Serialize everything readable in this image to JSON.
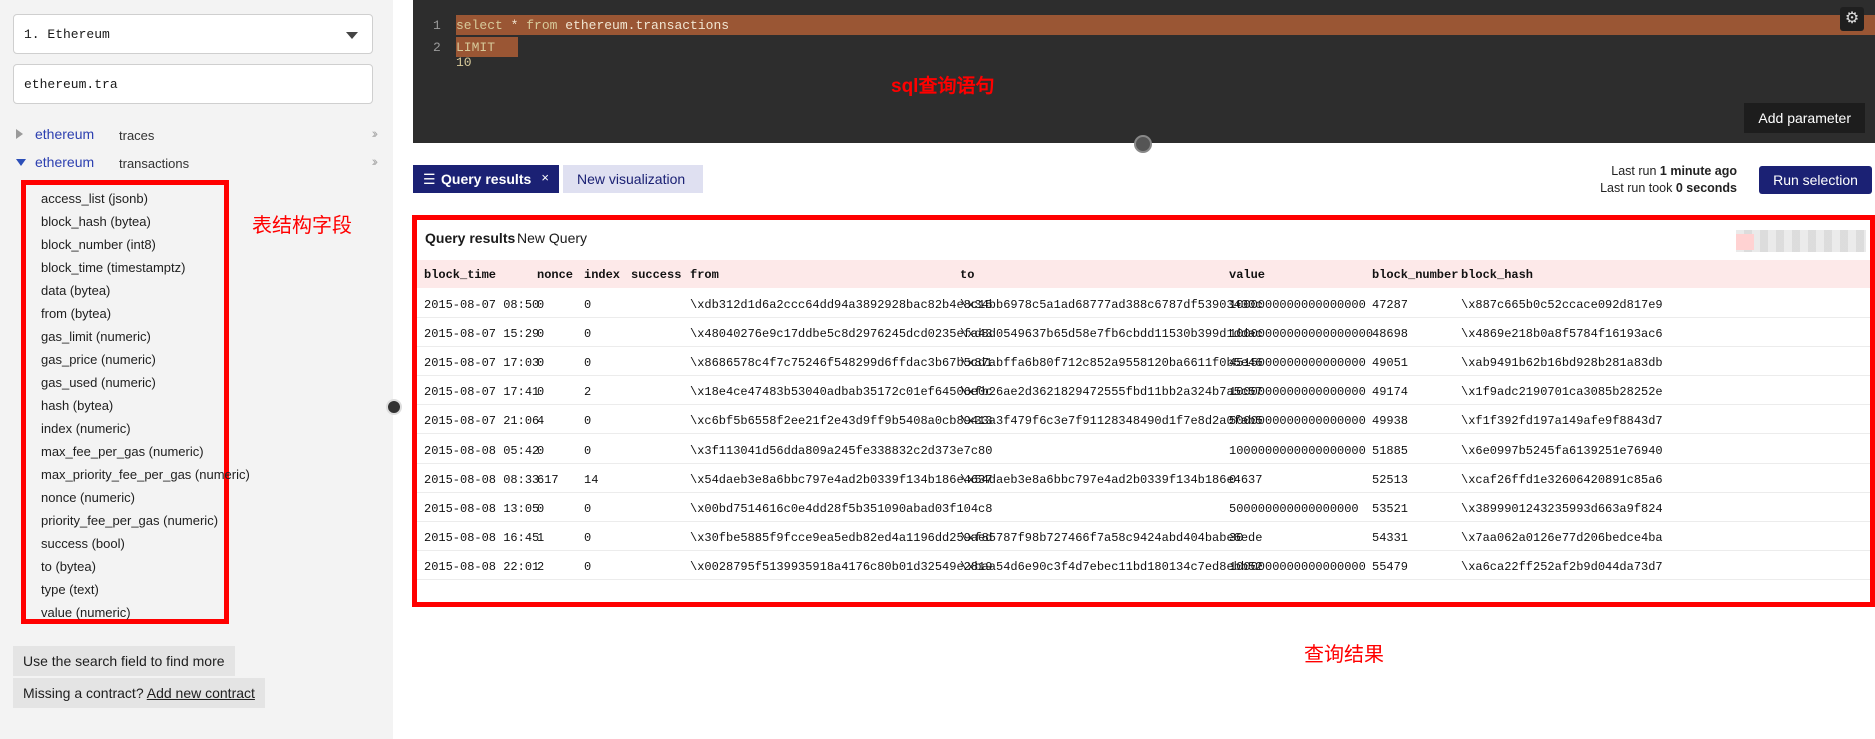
{
  "sidebar": {
    "dataset": "1. Ethereum",
    "search_value": "ethereum.tra",
    "tree": [
      {
        "namespace": "ethereum",
        "table": "traces",
        "expanded": false,
        "expand_icon": "double-chevron-right-icon"
      },
      {
        "namespace": "ethereum",
        "table": "transactions",
        "expanded": true,
        "expand_icon": "double-chevron-right-icon"
      }
    ],
    "fields": [
      "access_list (jsonb)",
      "block_hash (bytea)",
      "block_number (int8)",
      "block_time (timestamptz)",
      "data (bytea)",
      "from (bytea)",
      "gas_limit (numeric)",
      "gas_price (numeric)",
      "gas_used (numeric)",
      "hash (bytea)",
      "index (numeric)",
      "max_fee_per_gas (numeric)",
      "max_priority_fee_per_gas (numeric)",
      "nonce (numeric)",
      "priority_fee_per_gas (numeric)",
      "success (bool)",
      "to (bytea)",
      "type (text)",
      "value (numeric)"
    ],
    "hint_search": "Use the search field to find more",
    "hint_missing_prefix": "Missing a contract?",
    "hint_missing_link": "Add new contract"
  },
  "annotations": {
    "fields_label": "表结构字段",
    "sql_label": "sql查询语句",
    "results_label": "查询结果"
  },
  "editor": {
    "lines": [
      {
        "num": "1",
        "kw1": "select",
        "mid": " * ",
        "kw2": "from",
        "rest": " ethereum.transactions"
      },
      {
        "num": "2",
        "kw1": "LIMIT",
        "mid": " 10",
        "kw2": "",
        "rest": ""
      }
    ],
    "add_parameter": "Add parameter",
    "settings_icon": "gear-icon"
  },
  "results_bar": {
    "tab_active": "Query results",
    "tab_new": "New visualization",
    "last_run_prefix": "Last run",
    "last_run_value": "1 minute ago",
    "last_took_prefix": "Last run took",
    "last_took_value": "0 seconds",
    "run_button": "Run selection"
  },
  "results": {
    "title": "Query results",
    "subtitle": "New Query",
    "columns": [
      "block_time",
      "nonce",
      "index",
      "success",
      "from",
      "to",
      "value",
      "block_number",
      "block_hash"
    ],
    "rows": [
      [
        "2015-08-07 08:50",
        "0",
        "0",
        "",
        "\\xdb312d1d6a2ccc64dd94a3892928bac82b4e8c15",
        "\\x34bb6978c5a1ad68777ad388c6787df53903430c",
        "1000000000000000000",
        "47287",
        "\\x887c665b0c52ccace092d817e9"
      ],
      [
        "2015-08-07 15:29",
        "0",
        "0",
        "",
        "\\x48040276e9c17ddbe5c8d2976245dcd0235efa43",
        "\\xd8d0549637b65d58e7fb6cbdd11530b399d1ddac",
        "10000000000000000000",
        "48698",
        "\\x4869e218b0a8f5784f16193ac6"
      ],
      [
        "2015-08-07 17:03",
        "0",
        "0",
        "",
        "\\x8686578c4f7c75246f548299d6ffdac3b67b5cd1",
        "\\x87abffa6b80f712c852a9558120ba6611f0b5e46",
        "4515000000000000000",
        "49051",
        "\\xab9491b62b16bd928b281a83db"
      ],
      [
        "2015-08-07 17:41",
        "0",
        "2",
        "",
        "\\x18e4ce47483b53040adbab35172c01ef64506e0c",
        "\\xfb26ae2d3621829472555fbd11bb2a324b7a5c57",
        "1000000000000000000",
        "49174",
        "\\x1f9adc2190701ca3085b28252e"
      ],
      [
        "2015-08-07 21:06",
        "4",
        "0",
        "",
        "\\xc6bf5b6558f2ee21f2e43d9ff9b5408a0cb89413",
        "\\x33a3f479f6c3e7f91128348490d1f7e8d2a0fab5",
        "5000000000000000000",
        "49938",
        "\\xf1f392fd197a149afe9f8843d7"
      ],
      [
        "2015-08-08 05:42",
        "0",
        "0",
        "",
        "\\x3f113041d56dda809a245fe338832c2d373e7c80",
        "",
        "1000000000000000000",
        "51885",
        "\\x6e0997b5245fa6139251e76940"
      ],
      [
        "2015-08-08 08:33",
        "617",
        "14",
        "",
        "\\x54daeb3e8a6bbc797e4ad2b0339f134b186e4637",
        "\\x54daeb3e8a6bbc797e4ad2b0339f134b186e4637",
        "0",
        "52513",
        "\\xcaf26ffd1e32606420891c85a6"
      ],
      [
        "2015-08-08 13:05",
        "0",
        "0",
        "",
        "\\x00bd7514616c0e4dd28f5b351090abad03f104c8",
        "",
        "500000000000000000",
        "53521",
        "\\x3899901243235993d663a9f824"
      ],
      [
        "2015-08-08 16:45",
        "1",
        "0",
        "",
        "\\x30fbe5885f9fcce9ea5edb82ed4a1196dd259aed",
        "\\xf85787f98b727466f7a58c9424abd404babe6ede",
        "30",
        "54331",
        "\\x7aa062a0126e77d206bedce4ba"
      ],
      [
        "2015-08-08 22:01",
        "2",
        "0",
        "",
        "\\x0028795f5139935918a4176c80b01d32549e2819",
        "\\xbaa54d6e90c3f4d7ebec11bd180134c7ed8ebb52",
        "1000000000000000000",
        "55479",
        "\\xa6ca22ff252af2b9d044da73d7"
      ]
    ]
  }
}
